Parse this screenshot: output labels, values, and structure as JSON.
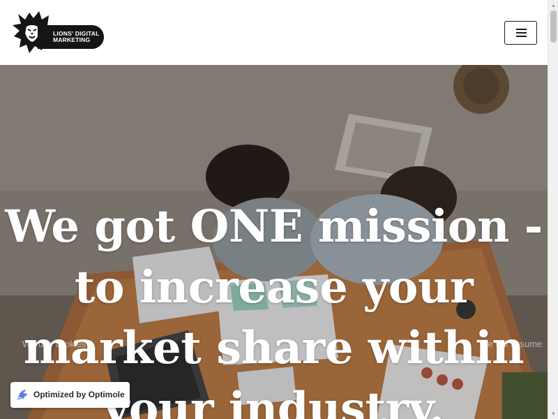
{
  "header": {
    "logo": {
      "line1": "LIONS' DIGITAL",
      "line2": "MARKETING"
    },
    "menu_icon": "hamburger-menu-icon"
  },
  "hero": {
    "headline": "We got ONE mission - to increase your market share within your industry.",
    "cookie_notice_left": "We use cookies",
    "cookie_notice_right": "we will assume"
  },
  "badge": {
    "label": "Optimized by Optimole",
    "icon": "optimole-logo-icon"
  },
  "colors": {
    "header_bg": "#ffffff",
    "logo_pill": "#151515",
    "headline_text": "#ffffff"
  }
}
